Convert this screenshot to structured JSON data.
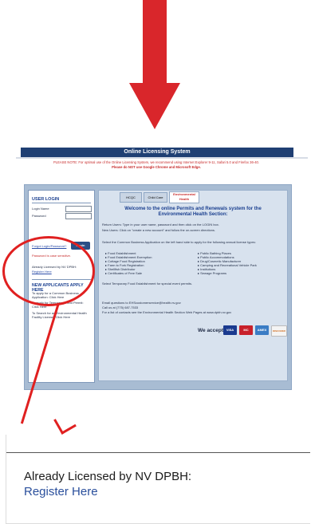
{
  "header": {
    "title": "Online Licensing System",
    "notice_line1": "PLEASE NOTE: For optimal use of the Online Licensing System, we recommend using Internet Explorer 9-11, Safari 5.0 and Firefox 36-40.",
    "notice_line2": "Please do NOT use Google Chrome and Microsoft Edge."
  },
  "login": {
    "heading": "USER LOGIN",
    "login_name_label": "Login Name",
    "password_label": "Password",
    "forgot_link": "Forgot Login/Password?",
    "case_sensitive": "Password is case sensitive.",
    "login_button": "Login",
    "already_licensed": "Already Licensed by NV DPBH:",
    "register_here": "Register Here"
  },
  "applicants": {
    "heading": "NEW APPLICANTS APPLY HERE",
    "common_business": "To apply for a Common Business Application: Click Here",
    "temp_food": "To apply for Temporary Food Permit: Click Here",
    "env_health": "To Search for an Environmental Health Facility License: Click Here"
  },
  "tabs": [
    {
      "label": "HCQC"
    },
    {
      "label": "Child Care"
    },
    {
      "label": "Environmental Health"
    }
  ],
  "welcome": {
    "title": "Welcome to the online Permits and Renewals system for the Environmental Health Section:",
    "return_users": "Return Users: Type in your user name, password and then click on the LOGIN box.",
    "new_users": "New Users: Click on \"create a new account\" and follow the on-screen directions.",
    "select_text": "Select the Common Business Application on the left hand side to apply for the following annual license types:",
    "left_list": [
      "Food Establishment",
      "Food Establishment Exemption",
      "Cottage Food Registration",
      "Farm to Fork Registration",
      "Shellfish Distributor",
      "Certificates of Free Sale"
    ],
    "right_list": [
      "Public Bathing Places",
      "Public Accommodations",
      "Drug/Cosmetic Manufacturer",
      "Camping and Recreational Vehicle Park",
      "Institutions",
      "Sewage Programs"
    ],
    "temp_food_text": "Select Temporary Food Establishment for special event permits.",
    "email": "Email questions to EHScustomerservice@health.nv.gov",
    "call": "Call us at (775) 687-7533",
    "contacts": "For a list of contacts see the Environmental Health Section Web Pages at www.dpbh.nv.gov",
    "we_accept": "We accept:",
    "cards": [
      "VISA",
      "MC",
      "AMEX",
      "DISCOVER"
    ]
  },
  "zoom": {
    "already_licensed": "Already Licensed by NV DPBH:",
    "register_here": "Register Here"
  },
  "colors": {
    "arrow": "#d9262b",
    "header_bar": "#1f3f73",
    "frame": "#a8bcd3",
    "link": "#2a4f9c"
  }
}
